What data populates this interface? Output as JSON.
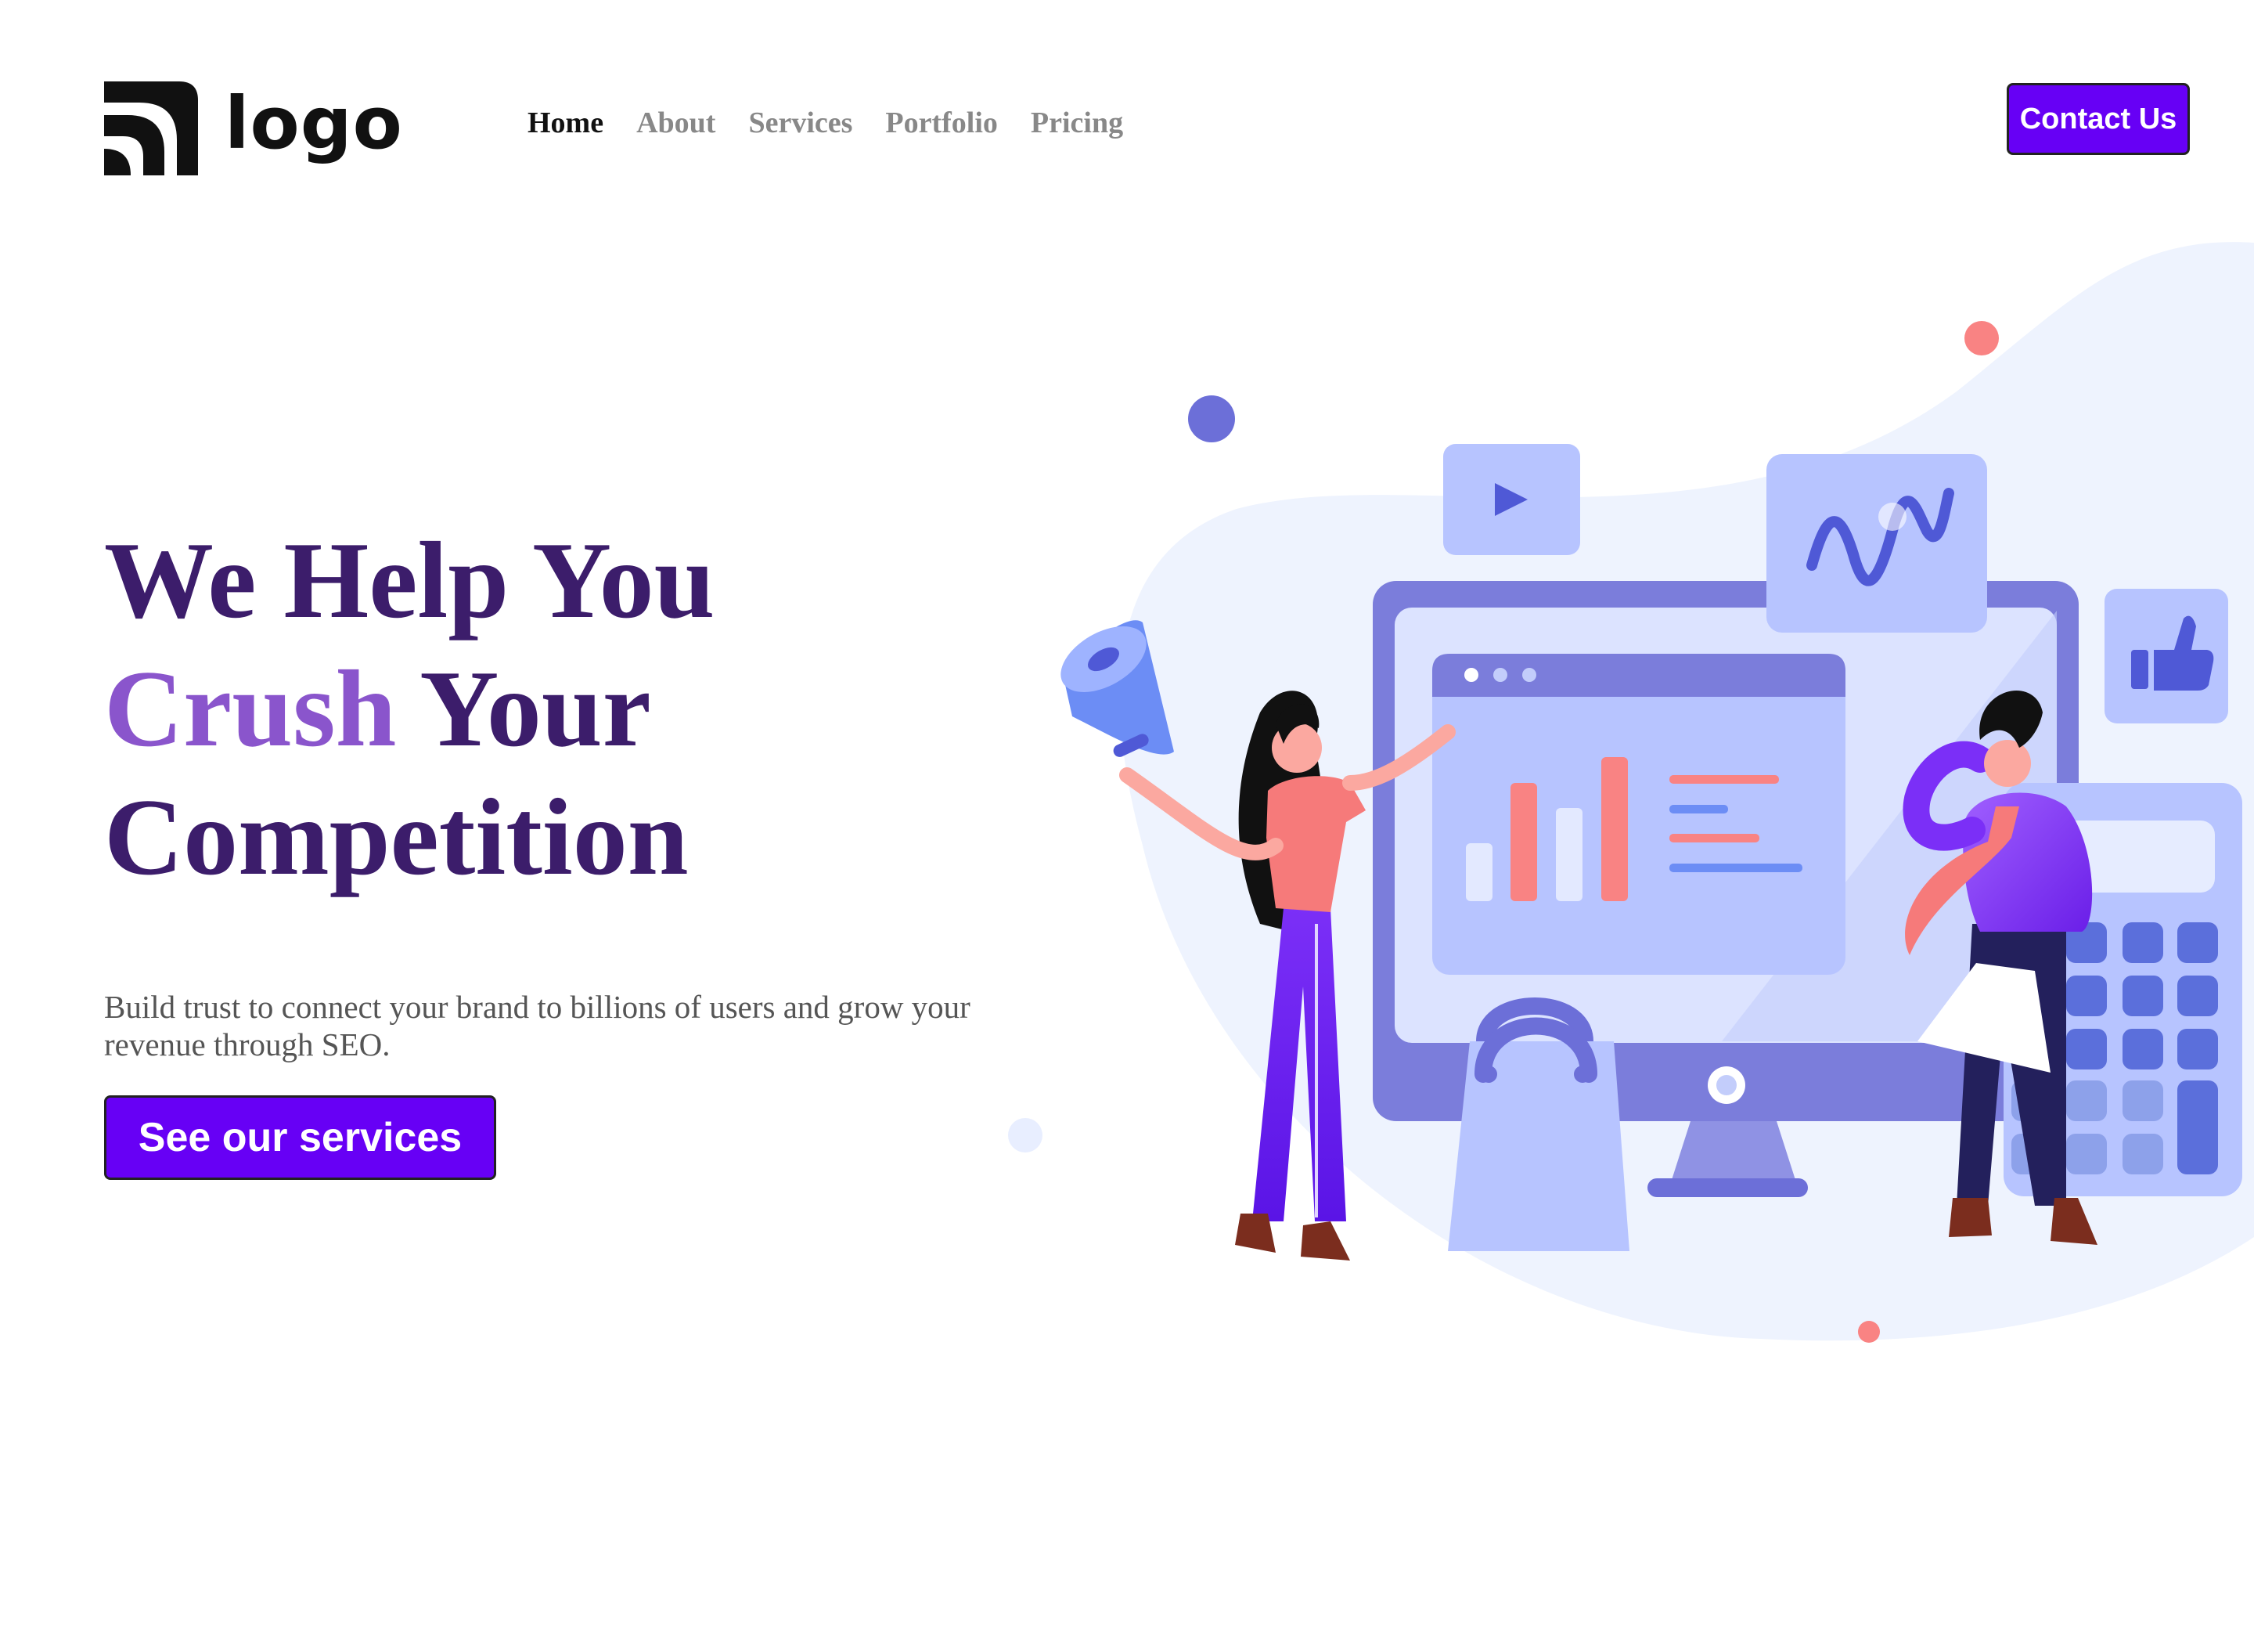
{
  "header": {
    "logo_text": "logo",
    "nav": [
      "Home",
      "About",
      "Services",
      "Portfolio",
      "Pricing"
    ],
    "active_nav": "Home",
    "contact_label": "Contact Us"
  },
  "hero": {
    "title_line1": "We Help You",
    "title_accent": "Crush",
    "title_line2_rest": " Your",
    "title_line3": "Competition",
    "subtitle": "Build trust to connect your brand to billions of users and grow your revenue through SEO.",
    "cta_label": "See our services"
  },
  "colors": {
    "brand": "#6700f5",
    "title": "#3c1d6b",
    "title_accent": "#8a55cc",
    "nav_active": "#111111",
    "nav_inactive": "#888888"
  },
  "icons": [
    "logo-mark-icon",
    "megaphone-icon",
    "play-icon",
    "wave-chart-icon",
    "thumbs-up-icon",
    "calculator-icon",
    "shopping-bag-icon"
  ]
}
